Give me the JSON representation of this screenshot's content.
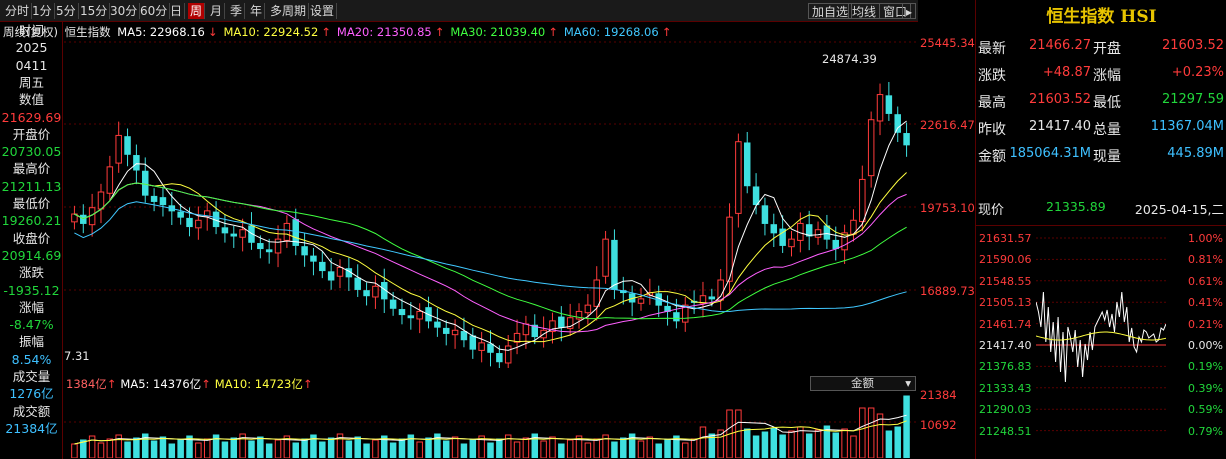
{
  "toolbar": {
    "periods": [
      "分时",
      "1分",
      "5分",
      "15分",
      "30分",
      "60分",
      "日",
      "周",
      "月",
      "季",
      "年",
      "多周期",
      "设置"
    ],
    "active_index": 7,
    "right_buttons": [
      "加自选",
      "均线",
      "窗口"
    ]
  },
  "legend": {
    "title": "周线(复权)",
    "name": "恒生指数",
    "ma": [
      {
        "label": "MA5: 22968.16",
        "arrow": "↓",
        "color": "#ffffff"
      },
      {
        "label": "MA10: 22924.52",
        "arrow": "↑",
        "color": "#ffff40"
      },
      {
        "label": "MA20: 21350.85",
        "arrow": "↑",
        "color": "#ff60ff"
      },
      {
        "label": "MA30: 21039.40",
        "arrow": "↑",
        "color": "#40ff40"
      },
      {
        "label": "MA60: 19268.06",
        "arrow": "↑",
        "color": "#40c8ff"
      }
    ]
  },
  "left_panel": [
    {
      "text": "时间",
      "cls": "lbl"
    },
    {
      "text": "2025",
      "cls": "lbl"
    },
    {
      "text": "0411",
      "cls": "lbl"
    },
    {
      "text": "周五",
      "cls": "lbl"
    },
    {
      "text": "数值",
      "cls": "lbl"
    },
    {
      "text": "21629.69",
      "cls": "red"
    },
    {
      "text": "开盘价",
      "cls": "lbl"
    },
    {
      "text": "20730.05",
      "cls": "grn"
    },
    {
      "text": "最高价",
      "cls": "lbl"
    },
    {
      "text": "21211.13",
      "cls": "grn"
    },
    {
      "text": "最低价",
      "cls": "lbl"
    },
    {
      "text": "19260.21",
      "cls": "grn"
    },
    {
      "text": "收盘价",
      "cls": "lbl"
    },
    {
      "text": "20914.69",
      "cls": "grn"
    },
    {
      "text": "涨跌",
      "cls": "lbl"
    },
    {
      "text": "-1935.12",
      "cls": "grn"
    },
    {
      "text": "涨幅",
      "cls": "lbl"
    },
    {
      "text": "-8.47%",
      "cls": "grn"
    },
    {
      "text": "振幅",
      "cls": "lbl"
    },
    {
      "text": "8.54%",
      "cls": "cyan"
    },
    {
      "text": "成交量",
      "cls": "lbl"
    },
    {
      "text": "1276亿",
      "cls": "cyan"
    },
    {
      "text": "成交额",
      "cls": "lbl"
    },
    {
      "text": "21384亿",
      "cls": "cyan"
    }
  ],
  "price_axis": [
    "25445.34",
    "22616.47",
    "19753.10",
    "16889.73"
  ],
  "peak_label": "24874.39",
  "low_label": "7.31",
  "volume": {
    "header": [
      {
        "text": "1384亿",
        "arrow": "↑",
        "color": "#ff6060"
      },
      {
        "text": "MA5: 14376亿",
        "arrow": "↑",
        "color": "#ffffff"
      },
      {
        "text": "MA10: 14723亿",
        "arrow": "↑",
        "color": "#ffff40"
      }
    ],
    "selector": "金额",
    "axis": [
      "21384",
      "10692"
    ]
  },
  "right_panel": {
    "title": "恒生指数 HSI",
    "quote": [
      {
        "l1": "最新",
        "v1": "21466.27",
        "c1": "#ff3b3b",
        "l2": "开盘",
        "v2": "21603.52",
        "c2": "#ff3b3b"
      },
      {
        "l1": "涨跌",
        "v1": "+48.87",
        "c1": "#ff3b3b",
        "l2": "涨幅",
        "v2": "+0.23%",
        "c2": "#ff3b3b"
      },
      {
        "l1": "最高",
        "v1": "21603.52",
        "c1": "#ff3b3b",
        "l2": "最低",
        "v2": "21297.59",
        "c2": "#21d63b"
      },
      {
        "l1": "昨收",
        "v1": "21417.40",
        "c1": "#e8e8e8",
        "l2": "总量",
        "v2": "11367.04M",
        "c2": "#3ec0ff"
      },
      {
        "l1": "金额",
        "v1": "185064.31M",
        "c1": "#3ec0ff",
        "l2": "现量",
        "v2": "445.89M",
        "c2": "#3ec0ff"
      }
    ],
    "now_label": "现价",
    "now_value": "21335.89",
    "now_date": "2025-04-15,二",
    "tick_prices": [
      {
        "text": "21631.57",
        "color": "#ff3b3b"
      },
      {
        "text": "21590.06",
        "color": "#ff3b3b"
      },
      {
        "text": "21548.55",
        "color": "#ff3b3b"
      },
      {
        "text": "21505.13",
        "color": "#ff3b3b"
      },
      {
        "text": "21461.74",
        "color": "#ff3b3b"
      },
      {
        "text": "21417.40",
        "color": "#e8e8e8"
      },
      {
        "text": "21376.83",
        "color": "#21d63b"
      },
      {
        "text": "21333.43",
        "color": "#21d63b"
      },
      {
        "text": "21290.03",
        "color": "#21d63b"
      },
      {
        "text": "21248.51",
        "color": "#21d63b"
      }
    ],
    "tick_pcts": [
      {
        "text": "1.00%",
        "color": "#ff3b3b"
      },
      {
        "text": "0.81%",
        "color": "#ff3b3b"
      },
      {
        "text": "0.61%",
        "color": "#ff3b3b"
      },
      {
        "text": "0.41%",
        "color": "#ff3b3b"
      },
      {
        "text": "0.21%",
        "color": "#ff3b3b"
      },
      {
        "text": "0.00%",
        "color": "#e8e8e8"
      },
      {
        "text": "0.19%",
        "color": "#21d63b"
      },
      {
        "text": "0.39%",
        "color": "#21d63b"
      },
      {
        "text": "0.59%",
        "color": "#21d63b"
      },
      {
        "text": "0.79%",
        "color": "#21d63b"
      }
    ]
  },
  "chart_data": {
    "type": "candlestick",
    "period": "weekly",
    "ylim": [
      15800,
      26300
    ],
    "closes": [
      20700,
      20400,
      20900,
      21400,
      22200,
      23200,
      22600,
      22100,
      21300,
      21100,
      21000,
      20800,
      20600,
      20300,
      20500,
      20800,
      20300,
      20100,
      20000,
      20200,
      19800,
      19600,
      19500,
      19900,
      20400,
      19700,
      19400,
      19200,
      18900,
      18600,
      19000,
      18700,
      18300,
      18100,
      18400,
      18000,
      17700,
      17500,
      17400,
      17600,
      17300,
      17100,
      16900,
      17000,
      16700,
      16400,
      16600,
      16300,
      16000,
      16500,
      16900,
      17200,
      16800,
      17000,
      17300,
      17100,
      17400,
      17600,
      17800,
      18600,
      19900,
      18300,
      18200,
      17900,
      18000,
      18200,
      17800,
      17600,
      17300,
      17800,
      17900,
      18100,
      18000,
      18600,
      20600,
      23000,
      21600,
      21000,
      20400,
      20100,
      19700,
      19900,
      20400,
      20000,
      20200,
      19900,
      19600,
      20100,
      20500,
      21800,
      23700,
      24500,
      23900,
      23300,
      22900
    ],
    "ma_series": [
      "MA5",
      "MA10",
      "MA20",
      "MA30",
      "MA60"
    ]
  }
}
